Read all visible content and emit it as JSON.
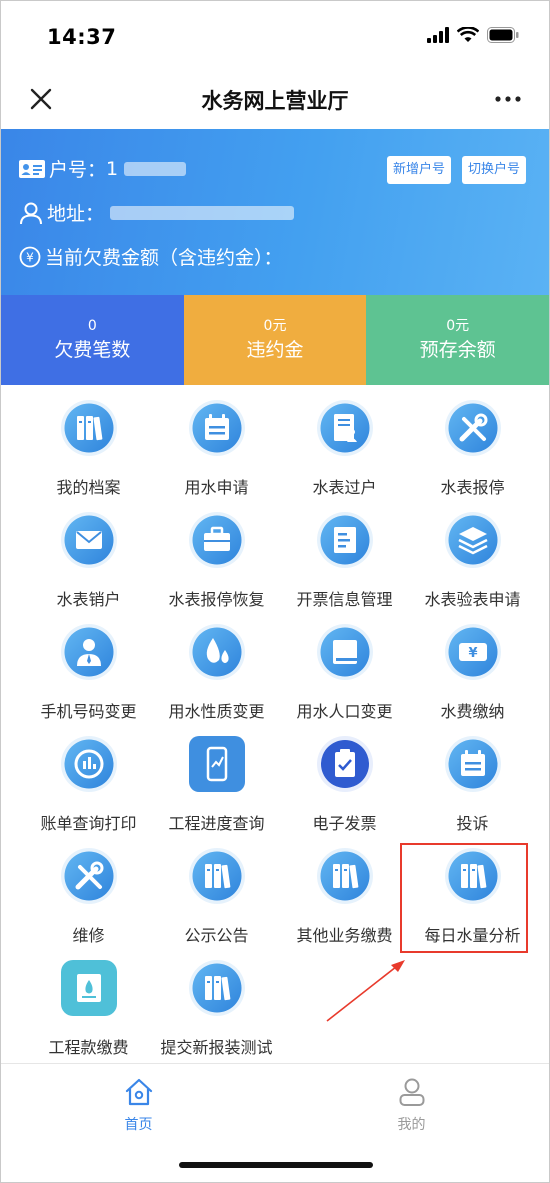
{
  "status": {
    "time": "14:37"
  },
  "nav": {
    "title": "水务网上营业厅"
  },
  "account": {
    "account_label": "户号：",
    "account_prefix": "1",
    "address_label": "地址：",
    "arrears_label": "当前欠费金额（含违约金）：",
    "btn_add": "新增户号",
    "btn_switch": "切换户号",
    "yen_symbol": "¥"
  },
  "stats": [
    {
      "value": "0",
      "label": "欠费笔数",
      "color": "#3f6fe4"
    },
    {
      "value": "0元",
      "label": "违约金",
      "color": "#f0ad3f"
    },
    {
      "value": "0元",
      "label": "预存余额",
      "color": "#5ec392"
    }
  ],
  "services": [
    {
      "label": "我的档案",
      "icon": "books-icon"
    },
    {
      "label": "用水申请",
      "icon": "calendar-icon"
    },
    {
      "label": "水表过户",
      "icon": "document-person-icon"
    },
    {
      "label": "水表报停",
      "icon": "tools-icon"
    },
    {
      "label": "水表销户",
      "icon": "envelope-icon"
    },
    {
      "label": "水表报停恢复",
      "icon": "briefcase-icon"
    },
    {
      "label": "开票信息管理",
      "icon": "invoice-icon"
    },
    {
      "label": "水表验表申请",
      "icon": "layers-icon"
    },
    {
      "label": "手机号码变更",
      "icon": "person-icon"
    },
    {
      "label": "用水性质变更",
      "icon": "water-drops-icon"
    },
    {
      "label": "用水人口变更",
      "icon": "book-icon"
    },
    {
      "label": "水费缴纳",
      "icon": "yen-bill-icon"
    },
    {
      "label": "账单查询打印",
      "icon": "chart-icon"
    },
    {
      "label": "工程进度查询",
      "icon": "phone-chart-icon"
    },
    {
      "label": "电子发票",
      "icon": "clipboard-icon"
    },
    {
      "label": "投诉",
      "icon": "calendar-icon"
    },
    {
      "label": "维修",
      "icon": "tools-icon"
    },
    {
      "label": "公示公告",
      "icon": "books-icon"
    },
    {
      "label": "其他业务缴费",
      "icon": "books-icon"
    },
    {
      "label": "每日水量分析",
      "icon": "books-icon"
    },
    {
      "label": "工程款缴费",
      "icon": "payment-doc-icon"
    },
    {
      "label": "提交新报装测试",
      "icon": "books-icon"
    }
  ],
  "tabs": [
    {
      "label": "首页",
      "icon": "home-icon",
      "active": true,
      "color": "#3a86e8"
    },
    {
      "label": "我的",
      "icon": "user-icon",
      "active": false,
      "color": "#9a9a9a"
    }
  ],
  "colors": {
    "accent": "#3a86e8",
    "annotation": "#e83a2c"
  }
}
